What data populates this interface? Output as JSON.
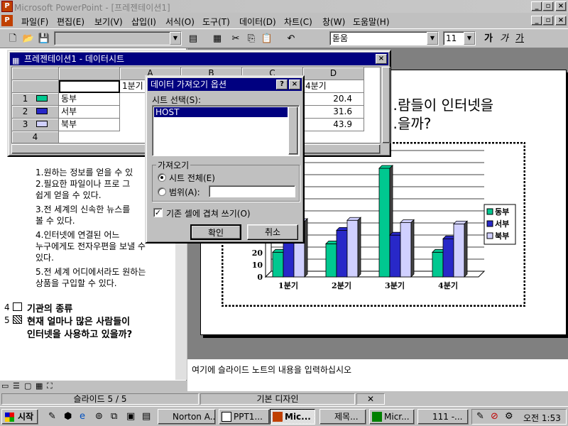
{
  "window": {
    "title": "Microsoft PowerPoint - [프레젠테이션1]",
    "controls": [
      "_",
      "▫",
      "×"
    ]
  },
  "menu": [
    "파일(F)",
    "편집(E)",
    "보기(V)",
    "삽입(I)",
    "서식(O)",
    "도구(T)",
    "데이터(D)",
    "차트(C)",
    "창(W)",
    "도움말(H)"
  ],
  "toolbar": {
    "font": "돋움",
    "size": "11",
    "bold": "가",
    "italic": "가",
    "underline": "가"
  },
  "datasheet": {
    "title": "프레젠테이션1 - 데이터시트",
    "columns": [
      "A",
      "B",
      "C",
      "D"
    ],
    "header_row": [
      "",
      "1분기",
      "2분기",
      "3분기",
      "4분기"
    ],
    "rows": [
      {
        "num": "1",
        "label": "동부",
        "d": "20.4"
      },
      {
        "num": "2",
        "label": "서부",
        "d": "31.6"
      },
      {
        "num": "3",
        "label": "북부",
        "d": "43.9"
      },
      {
        "num": "4",
        "label": "",
        "d": ""
      }
    ]
  },
  "dialog": {
    "title": "데이터 가져오기 옵션",
    "sheet_label": "시트 선택(S):",
    "sheet_selected": "HOST",
    "import_group": "가져오기",
    "opt_all": "시트 전체(E)",
    "opt_range": "범위(A):",
    "overwrite": "기존 셀에 겹쳐 쓰기(O)",
    "ok": "확인",
    "cancel": "취소"
  },
  "outline": {
    "items": [
      "1.원하는 정보를 얻을 수 있",
      "2.필요한  파일이나 프로 그",
      "  쉽게 얻을 수 있다.",
      "3.전 세계의 신속한 뉴스를",
      "  볼 수 있다.",
      "4.인터넷에 연결된 어느",
      "  누구에게도 전자우편을 보낼 수",
      "  있다.",
      "5.전 세계 어디에서라도 원하는",
      "  상품을 구입할 수 있다."
    ],
    "slide4": "기관의 종류",
    "slide5_line1": "현재 얼마나 많은 사람들이",
    "slide5_line2": "인터넷을 사용하고 있을까?",
    "num4": "4",
    "num5": "5"
  },
  "slide": {
    "title": "…람들이 인터넷을\n…을까?"
  },
  "chart_data": {
    "type": "bar",
    "categories": [
      "1분기",
      "2분기",
      "3분기",
      "4분기"
    ],
    "series": [
      {
        "name": "동부",
        "values": [
          20.4,
          27.4,
          90,
          20.4
        ],
        "color": "#00c890"
      },
      {
        "name": "서부",
        "values": [
          30.6,
          38.6,
          34.6,
          31.6
        ],
        "color": "#2828c8"
      },
      {
        "name": "북부",
        "values": [
          45.9,
          46.9,
          45,
          43.9
        ],
        "color": "#d0d0ff"
      }
    ],
    "yticks": [
      "0",
      "10",
      "20"
    ],
    "ylim": [
      0,
      100
    ],
    "legend": "right"
  },
  "notes": "여기에 슬라이드 노트의 내용을 입력하십시오",
  "status": {
    "slide": "슬라이드 5 / 5",
    "design": "기본 디자인"
  },
  "taskbar": {
    "start": "시작",
    "tasks": [
      "Norton A...",
      "PPT1...",
      "Mic...",
      "제목...",
      "Micr...",
      "111 -..."
    ],
    "clock": "오전 1:53"
  }
}
